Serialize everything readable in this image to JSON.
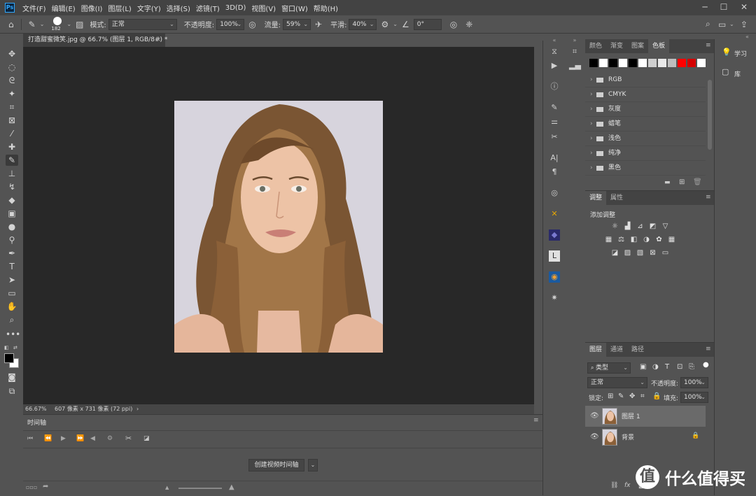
{
  "app": {
    "logo": "Ps"
  },
  "menu": [
    "文件(F)",
    "编辑(E)",
    "图像(I)",
    "图层(L)",
    "文字(Y)",
    "选择(S)",
    "滤镜(T)",
    "3D(D)",
    "视图(V)",
    "窗口(W)",
    "帮助(H)"
  ],
  "window_controls": {
    "minimize": "─",
    "maximize": "☐",
    "close": "✕"
  },
  "options": {
    "brush_size": "182",
    "mode_label": "模式:",
    "mode_value": "正常",
    "opacity_label": "不透明度:",
    "opacity_value": "100%",
    "flow_label": "流量:",
    "flow_value": "59%",
    "smooth_label": "平滑:",
    "smooth_value": "40%",
    "angle_value": "0°"
  },
  "document": {
    "tab_title": "打造甜蜜微笑.jpg @ 66.7% (图层 1, RGB/8#) *",
    "close": "×",
    "zoom": "66.67%",
    "doc_info": "607 像素 x 731 像素 (72 ppi)",
    "info_arrow": "›"
  },
  "timeline": {
    "title": "时间轴",
    "create_button": "创建视频时间轴",
    "dropdown": "⌄"
  },
  "swatches_panel": {
    "tabs": [
      "颜色",
      "渐变",
      "图案",
      "色板"
    ],
    "active_tab": 3,
    "swatches": [
      "#000000",
      "#ffffff",
      "#000000",
      "#ffffff",
      "#000000",
      "#ffffff",
      "#cfcfcf",
      "#e8e8e8",
      "#bdbdbd",
      "#ff0000",
      "#d40000",
      "#ffffff"
    ],
    "folders": [
      "RGB",
      "CMYK",
      "灰度",
      "蜡笔",
      "浅色",
      "纯净",
      "黑色"
    ]
  },
  "adjust_panel": {
    "tabs": [
      "调整",
      "属性"
    ],
    "add_label": "添加调整"
  },
  "layers_panel": {
    "tabs": [
      "图层",
      "通道",
      "路径"
    ],
    "filter_kind": "类型",
    "blend_mode": "正常",
    "opacity_label": "不透明度:",
    "opacity_value": "100%",
    "lock_label": "锁定:",
    "fill_label": "填充:",
    "fill_value": "100%",
    "layers": [
      {
        "name": "图层 1",
        "selected": true
      },
      {
        "name": "背景",
        "locked": true
      }
    ],
    "bottom_fx": "fx"
  },
  "right_dock": {
    "learn": "学习",
    "library": "库"
  },
  "watermark": {
    "badge": "值",
    "text": "什么值得买"
  }
}
